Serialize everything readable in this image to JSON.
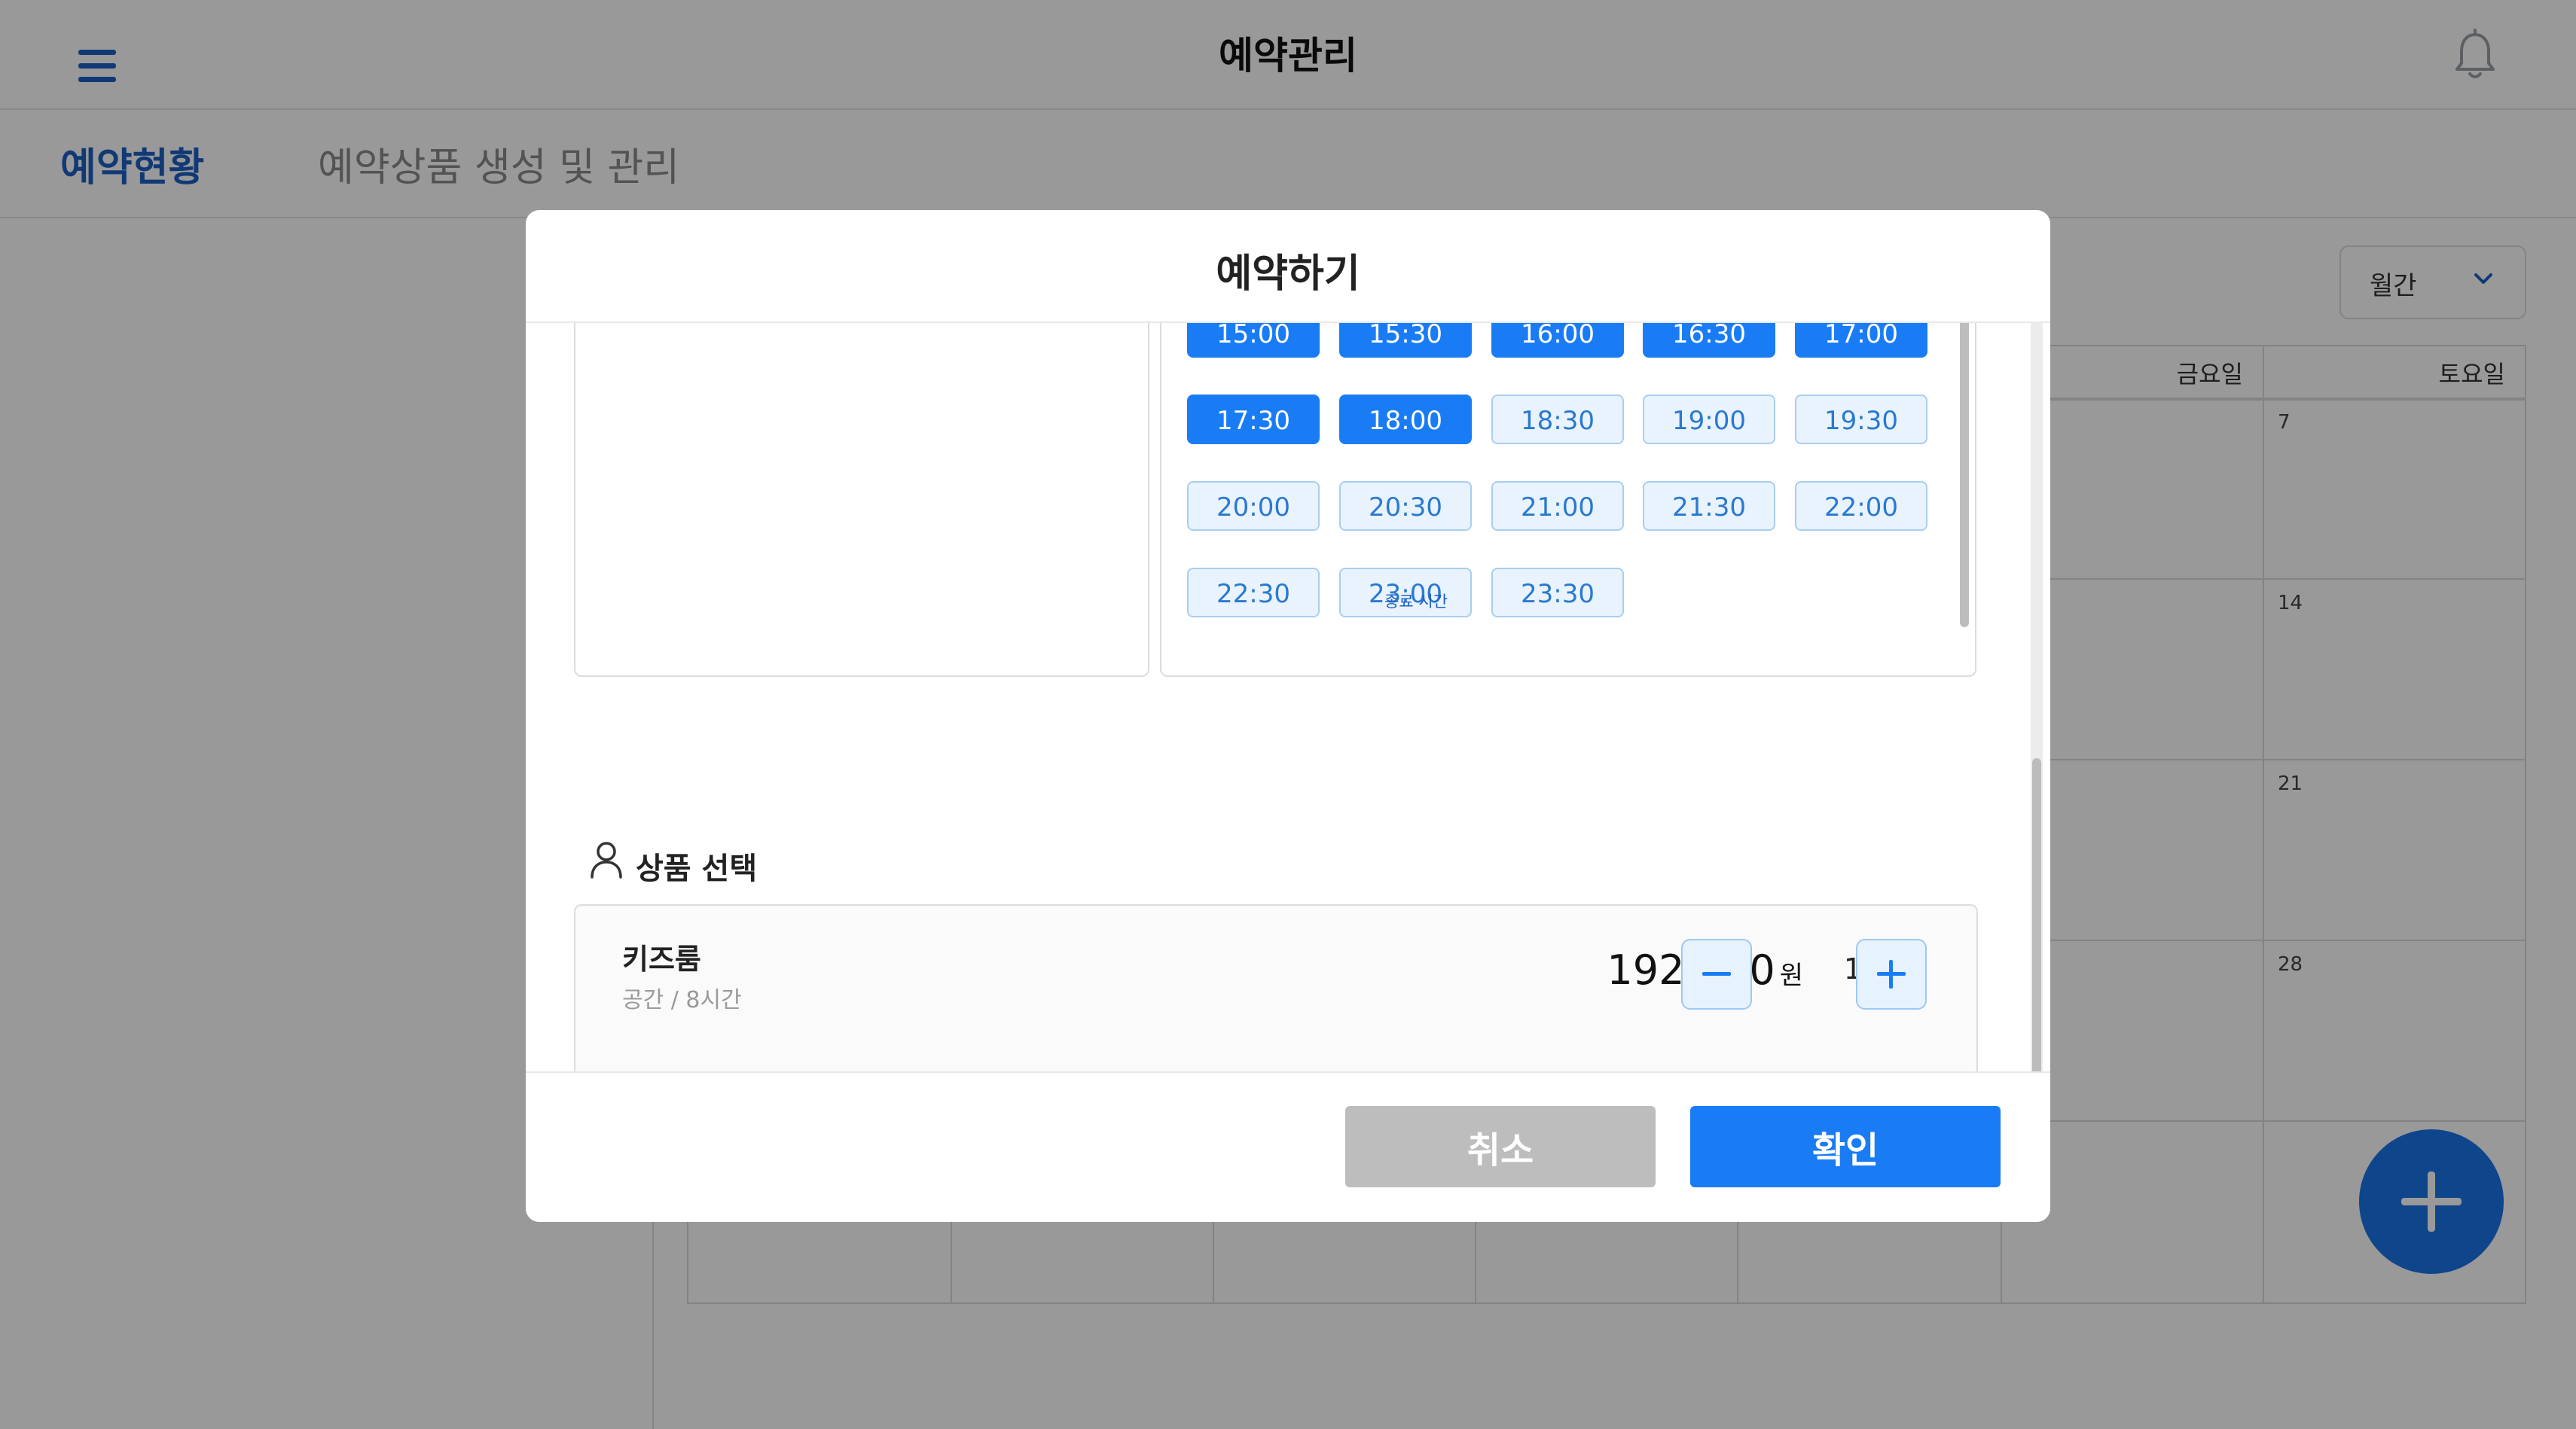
{
  "header": {
    "title": "예약관리"
  },
  "tabs": [
    {
      "label": "예약현황",
      "active": true
    },
    {
      "label": "예약상품 생성 및 관리",
      "active": false
    }
  ],
  "view_select": {
    "value": "월간"
  },
  "calendar": {
    "weekday_headers": [
      "금요일",
      "토요일"
    ],
    "saturday_dates": [
      "7",
      "14",
      "21",
      "28"
    ]
  },
  "modal": {
    "title": "예약하기",
    "end_time_label": "종료 시간",
    "time_slots": [
      {
        "time": "15:00",
        "selected": true
      },
      {
        "time": "15:30",
        "selected": true
      },
      {
        "time": "16:00",
        "selected": true
      },
      {
        "time": "16:30",
        "selected": true
      },
      {
        "time": "17:00",
        "selected": true
      },
      {
        "time": "17:30",
        "selected": true
      },
      {
        "time": "18:00",
        "selected": true
      },
      {
        "time": "18:30",
        "selected": false
      },
      {
        "time": "19:00",
        "selected": false
      },
      {
        "time": "19:30",
        "selected": false
      },
      {
        "time": "20:00",
        "selected": false
      },
      {
        "time": "20:30",
        "selected": false
      },
      {
        "time": "21:00",
        "selected": false
      },
      {
        "time": "21:30",
        "selected": false
      },
      {
        "time": "22:00",
        "selected": false
      },
      {
        "time": "22:30",
        "selected": false
      },
      {
        "time": "23:00",
        "selected": false
      },
      {
        "time": "23:30",
        "selected": false
      }
    ],
    "product_section": {
      "title": "상품 선택",
      "product": {
        "name": "키즈룸",
        "subtitle": "공간 / 8시간",
        "price": "192,000",
        "price_unit": "원",
        "quantity": "1"
      }
    },
    "buttons": {
      "cancel": "취소",
      "confirm": "확인"
    }
  },
  "colors": {
    "accent": "#1a7cf5",
    "tab_active": "#1d5fc4",
    "slot_unselected_bg": "#e8f3fd",
    "cancel_button": "#bdbdbd"
  },
  "icons": [
    "menu-icon",
    "bell-icon",
    "chevron-down-icon",
    "user-icon",
    "minus-icon",
    "plus-icon"
  ]
}
